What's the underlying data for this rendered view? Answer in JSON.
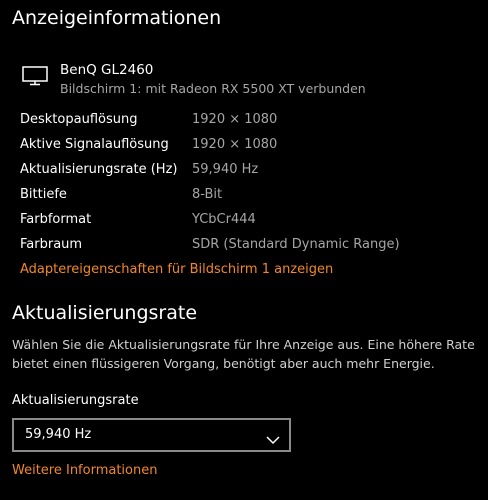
{
  "display_info": {
    "title": "Anzeigeinformationen",
    "monitor": {
      "icon": "monitor-icon",
      "name": "BenQ GL2460",
      "subtitle": "Bildschirm 1: mit Radeon RX 5500 XT verbunden"
    },
    "rows": [
      {
        "label": "Desktopauflösung",
        "value": "1920 × 1080"
      },
      {
        "label": "Aktive Signalauflösung",
        "value": "1920 × 1080"
      },
      {
        "label": "Aktualisierungsrate (Hz)",
        "value": "59,940 Hz"
      },
      {
        "label": "Bittiefe",
        "value": "8-Bit"
      },
      {
        "label": "Farbformat",
        "value": "YCbCr444"
      },
      {
        "label": "Farbraum",
        "value": "SDR (Standard Dynamic Range)"
      }
    ],
    "adapter_link": "Adaptereigenschaften für Bildschirm 1 anzeigen"
  },
  "refresh_rate": {
    "title": "Aktualisierungsrate",
    "description": "Wählen Sie die Aktualisierungsrate für Ihre Anzeige aus. Eine höhere Rate bietet einen flüssigeren Vorgang, benötigt aber auch mehr Energie.",
    "dropdown_label": "Aktualisierungsrate",
    "selected_value": "59,940 Hz",
    "more_info_link": "Weitere Informationen"
  },
  "colors": {
    "background": "#000000",
    "text": "#ffffff",
    "secondary_text": "#a6a6a6",
    "link_accent": "#f0882a",
    "dropdown_border": "#8a8a8a"
  }
}
